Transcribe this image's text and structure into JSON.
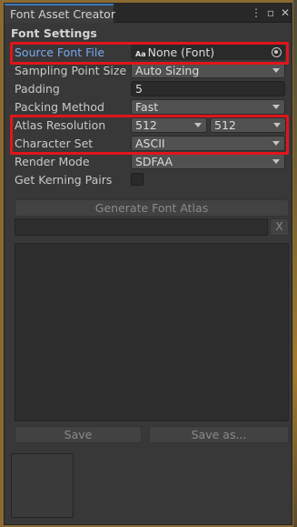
{
  "window": {
    "tab_title": "Font Asset Creator",
    "menu_icon": "kebab-menu-icon",
    "maximize_icon": "maximize-icon",
    "close_icon": "close-icon"
  },
  "section_title": "Font Settings",
  "fields": {
    "source_font": {
      "label": "Source Font File",
      "value": "None (Font)",
      "type_icon": "Aa"
    },
    "sampling": {
      "label": "Sampling Point Size",
      "value": "Auto Sizing"
    },
    "padding": {
      "label": "Padding",
      "value": "5"
    },
    "packing": {
      "label": "Packing Method",
      "value": "Fast"
    },
    "atlas": {
      "label": "Atlas Resolution",
      "width": "512",
      "height": "512"
    },
    "charset": {
      "label": "Character Set",
      "value": "ASCII"
    },
    "render_mode": {
      "label": "Render Mode",
      "value": "SDFAA"
    },
    "kerning": {
      "label": "Get Kerning Pairs",
      "checked": false
    }
  },
  "buttons": {
    "generate": "Generate Font Atlas",
    "clear": "X",
    "save": "Save",
    "save_as": "Save as..."
  },
  "progress": 0.0,
  "colors": {
    "highlight": "#e0151c",
    "label_accent": "#7ba9ee",
    "panel_bg": "#383838"
  }
}
